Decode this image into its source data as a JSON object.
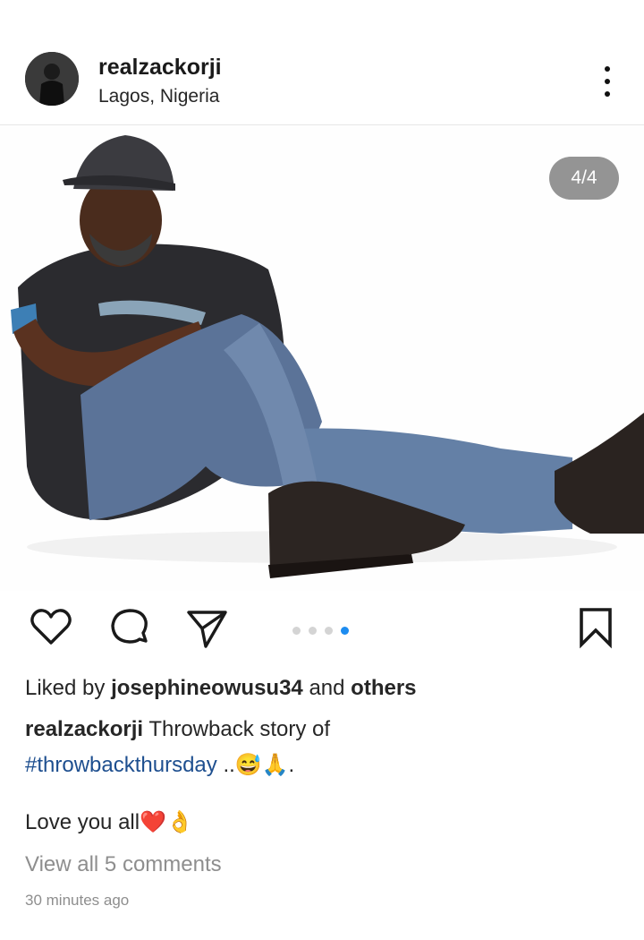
{
  "post": {
    "username": "realzackorji",
    "location": "Lagos, Nigeria",
    "image_counter": "4/4",
    "carousel": {
      "total": 4,
      "active": 4
    },
    "liked_by_prefix": "Liked by ",
    "liked_by_user": "josephineowusu34",
    "liked_by_suffix": " and ",
    "liked_by_others": "others",
    "caption_user": "realzackorji",
    "caption_text": " Throwback story of",
    "caption_hashtag": "#throwbackthursday",
    "caption_tail": " ..😅🙏.",
    "caption_line2": "Love you all❤️👌",
    "view_comments": "View all 5 comments",
    "timestamp": "30 minutes ago"
  },
  "icons": {
    "like": "heart-icon",
    "comment": "comment-bubble-icon",
    "share": "paper-plane-icon",
    "save": "bookmark-icon",
    "more": "vertical-ellipsis-icon"
  },
  "colors": {
    "accent": "#1d8cf0",
    "hashtag": "#1e4f8f",
    "muted": "#8e8e8e"
  }
}
